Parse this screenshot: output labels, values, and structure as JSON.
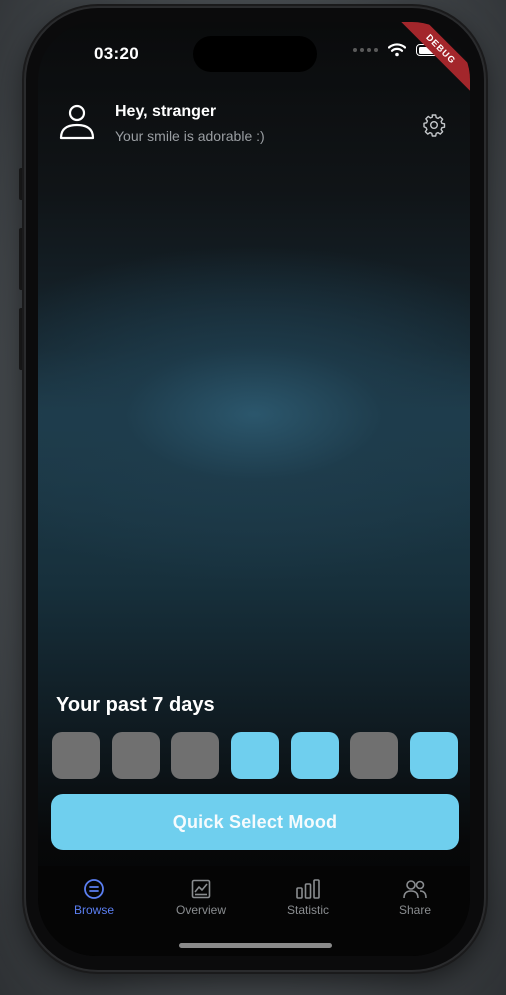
{
  "status_bar": {
    "time": "03:20"
  },
  "debug_banner": "DEBUG",
  "header": {
    "greeting": "Hey, stranger",
    "subtitle": "Your smile is adorable :)",
    "avatar_icon": "person-outline-icon",
    "settings_icon": "gear-icon"
  },
  "past_days": {
    "title": "Your past 7 days",
    "days": [
      {
        "state": "empty",
        "color": "#707070"
      },
      {
        "state": "empty",
        "color": "#707070"
      },
      {
        "state": "empty",
        "color": "#707070"
      },
      {
        "state": "logged",
        "color": "#6fcfee"
      },
      {
        "state": "logged",
        "color": "#6fcfee"
      },
      {
        "state": "empty",
        "color": "#707070"
      },
      {
        "state": "logged",
        "color": "#6fcfee"
      }
    ]
  },
  "quick_select": {
    "label": "Quick Select Mood",
    "color": "#6fcfee"
  },
  "tabs": [
    {
      "label": "Browse",
      "icon": "list-circle-icon",
      "active": true
    },
    {
      "label": "Overview",
      "icon": "image-chart-icon",
      "active": false
    },
    {
      "label": "Statistic",
      "icon": "bar-chart-icon",
      "active": false
    },
    {
      "label": "Share",
      "icon": "people-icon",
      "active": false
    }
  ],
  "colors": {
    "accent": "#6fcfee",
    "tab_active": "#5b7ff2",
    "tab_inactive": "#8a8d90",
    "day_empty": "#707070"
  }
}
